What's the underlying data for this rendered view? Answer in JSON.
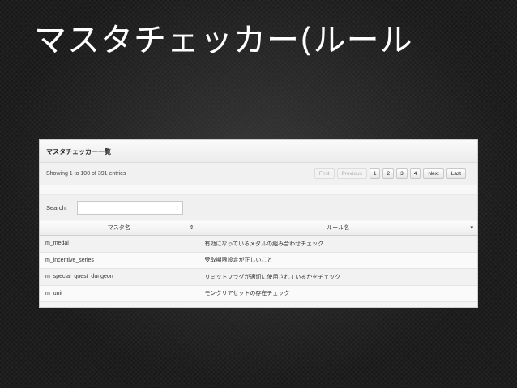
{
  "slide": {
    "title": "マスタチェッカー(ルール"
  },
  "panel": {
    "header": "マスタチェッカー一覧",
    "info": "Showing 1 to 100 of 391 entries",
    "pager": {
      "first": "First",
      "previous": "Previous",
      "pages": [
        "1",
        "2",
        "3",
        "4"
      ],
      "next": "Next",
      "last": "Last"
    },
    "search_label": "Search:",
    "search_value": "",
    "columns": {
      "master": "マスタ名",
      "master_sort_icon": "sort-both-icon",
      "rule": "ルール名",
      "rule_sort_icon": "sort-desc-icon"
    },
    "rows": [
      {
        "master": "m_medal",
        "rule": "有効になっているメダルの組み合わせチェック"
      },
      {
        "master": "m_incentive_series",
        "rule": "受取期限設定が正しいこと"
      },
      {
        "master": "m_special_quest_dungeon",
        "rule": "リミットフラグが適切に使用されているかをチェック"
      },
      {
        "master": "m_unit",
        "rule": "モンクリアセットの存在チェック"
      }
    ]
  }
}
